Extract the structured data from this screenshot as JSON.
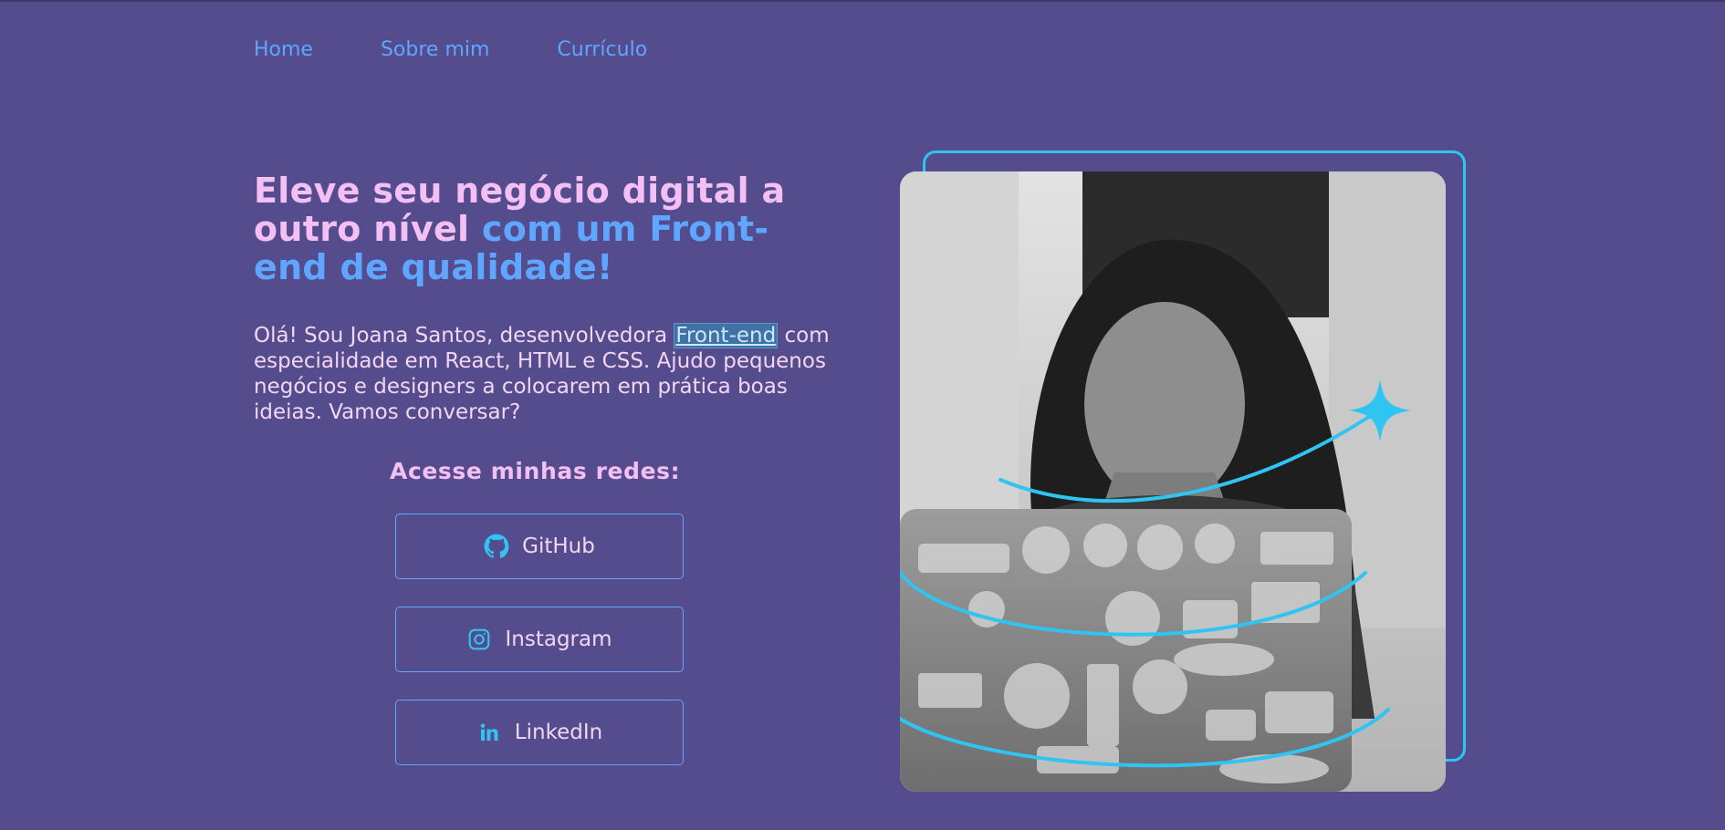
{
  "nav": {
    "home": "Home",
    "sobre": "Sobre mim",
    "curriculo": "Currículo"
  },
  "hero": {
    "headline_part1": "Eleve seu negócio digital a outro nível ",
    "headline_part2": "com um Front-end de qualidade!",
    "intro_before": "Olá! Sou Joana Santos, desenvolvedora ",
    "intro_highlight": "Front-end",
    "intro_after": " com especialidade em React, HTML e CSS. Ajudo pequenos negócios e designers a colocarem em prática boas ideias. Vamos conversar?"
  },
  "social": {
    "title": "Acesse minhas redes:",
    "buttons": [
      {
        "label": "GitHub",
        "icon": "github-icon"
      },
      {
        "label": "Instagram",
        "icon": "instagram-icon"
      },
      {
        "label": "LinkedIn",
        "icon": "linkedin-icon"
      }
    ]
  },
  "colors": {
    "background": "#554c8e",
    "pink": "#f4bff5",
    "blue": "#5ea6ff",
    "cyan_accent": "#2fc4f2"
  }
}
